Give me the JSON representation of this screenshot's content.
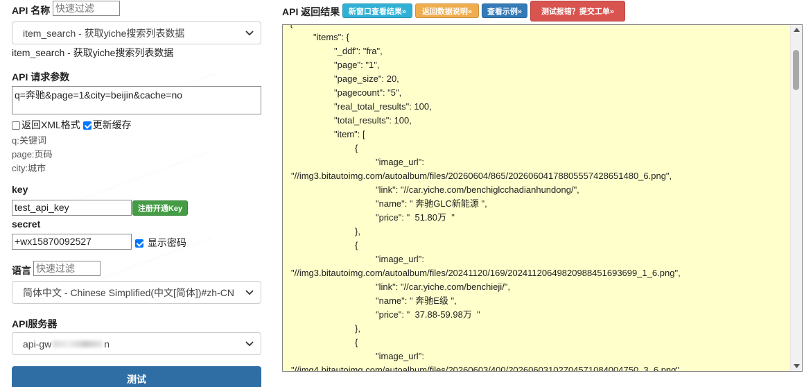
{
  "left": {
    "api_name_label": "API 名称",
    "api_filter_placeholder": "快速过滤",
    "api_select_value": "item_search - 获取yiche搜索列表数据",
    "api_description": "item_search - 获取yiche搜索列表数据",
    "params_label": "API 请求参数",
    "params_value": "q=奔驰&page=1&city=beijin&cache=no",
    "xml_checkbox_label": "返回XML格式",
    "xml_checked": false,
    "cache_checkbox_label": "更新缓存",
    "cache_checked": true,
    "param_hints": [
      "q:关键词",
      "page:页码",
      "city:城市"
    ],
    "key_label": "key",
    "key_value": "test_api_key",
    "register_button": "注册开通Key",
    "secret_label": "secret",
    "secret_value": "+wx15870092527",
    "show_password_label": "显示密码",
    "show_password_checked": true,
    "lang_label": "语言",
    "lang_filter_placeholder": "快速过滤",
    "lang_select_value": "简体中文 - Chinese Simplified(中文[简体])#zh-CN",
    "server_label": "API服务器",
    "server_select_value": "api-gw",
    "server_select_suffix": "n",
    "test_button": "测试"
  },
  "right": {
    "result_label": "API 返回结果",
    "buttons": [
      {
        "label": "新窗口查看结果»",
        "color": "#31b0d5"
      },
      {
        "label": "返回数据说明»",
        "color": "#f0ad4e"
      },
      {
        "label": "查看示例»",
        "color": "#337ab7"
      },
      {
        "label": "测试报错？提交工单»",
        "color": "#d9534f"
      }
    ],
    "json_lines": [
      {
        "indent": 0,
        "text": "{"
      },
      {
        "indent": 1,
        "text": "\"items\": {"
      },
      {
        "indent": 2,
        "text": "\"_ddf\": \"fra\","
      },
      {
        "indent": 2,
        "text": "\"page\": \"1\","
      },
      {
        "indent": 2,
        "text": "\"page_size\": 20,"
      },
      {
        "indent": 2,
        "text": "\"pagecount\": \"5\","
      },
      {
        "indent": 2,
        "text": "\"real_total_results\": 100,"
      },
      {
        "indent": 2,
        "text": "\"total_results\": 100,"
      },
      {
        "indent": 2,
        "text": "\"item\": ["
      },
      {
        "indent": 3,
        "text": "{"
      },
      {
        "indent": 4,
        "text": "\"image_url\":"
      },
      {
        "indent": 0,
        "text": "\"//img3.bitautoimg.com/autoalbum/files/20260604/865/20260604178805557428651480_6.png\","
      },
      {
        "indent": 4,
        "text": "\"link\": \"//car.yiche.com/benchiglcchadianhundong/\","
      },
      {
        "indent": 4,
        "text": "\"name\": \" 奔驰GLC新能源 \","
      },
      {
        "indent": 4,
        "text": "\"price\": \"  51.80万  \""
      },
      {
        "indent": 3,
        "text": "},"
      },
      {
        "indent": 3,
        "text": "{"
      },
      {
        "indent": 4,
        "text": "\"image_url\":"
      },
      {
        "indent": 0,
        "text": "\"//img3.bitautoimg.com/autoalbum/files/20241120/169/20241120649820988451693699_1_6.png\","
      },
      {
        "indent": 4,
        "text": "\"link\": \"//car.yiche.com/benchieji/\","
      },
      {
        "indent": 4,
        "text": "\"name\": \" 奔驰E级 \","
      },
      {
        "indent": 4,
        "text": "\"price\": \"  37.88-59.98万  \""
      },
      {
        "indent": 3,
        "text": "},"
      },
      {
        "indent": 3,
        "text": "{"
      },
      {
        "indent": 4,
        "text": "\"image_url\":"
      },
      {
        "indent": 0,
        "text": "\"//img4.bitautoimg.com/autoalbum/files/20260603/400/20260603102704571084004750_3_6.png\","
      }
    ]
  }
}
